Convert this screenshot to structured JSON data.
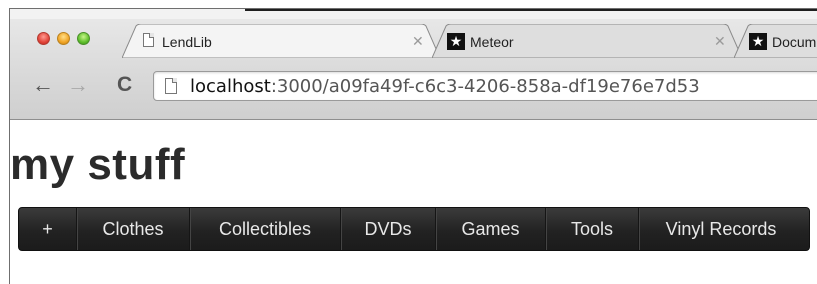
{
  "window": {
    "controls": [
      "close",
      "minimize",
      "zoom"
    ]
  },
  "tabs": [
    {
      "label": "LendLib",
      "icon": "page-icon",
      "active": true
    },
    {
      "label": "Meteor",
      "icon": "meteor-star-icon",
      "active": false
    },
    {
      "label": "Docum",
      "icon": "meteor-star-icon",
      "active": false
    }
  ],
  "toolbar": {
    "back": "←",
    "forward": "→",
    "reload": "C",
    "url_host": "localhost",
    "url_path": ":3000/a09fa49f-c6c3-4206-858a-df19e76e7d53"
  },
  "page": {
    "title": "my stuff",
    "nav": [
      "+",
      "Clothes",
      "Collectibles",
      "DVDs",
      "Games",
      "Tools",
      "Vinyl Records"
    ]
  },
  "colors": {
    "navbar": "#222222",
    "nav_text": "#e8e8e8",
    "title": "#2b2b2b"
  }
}
